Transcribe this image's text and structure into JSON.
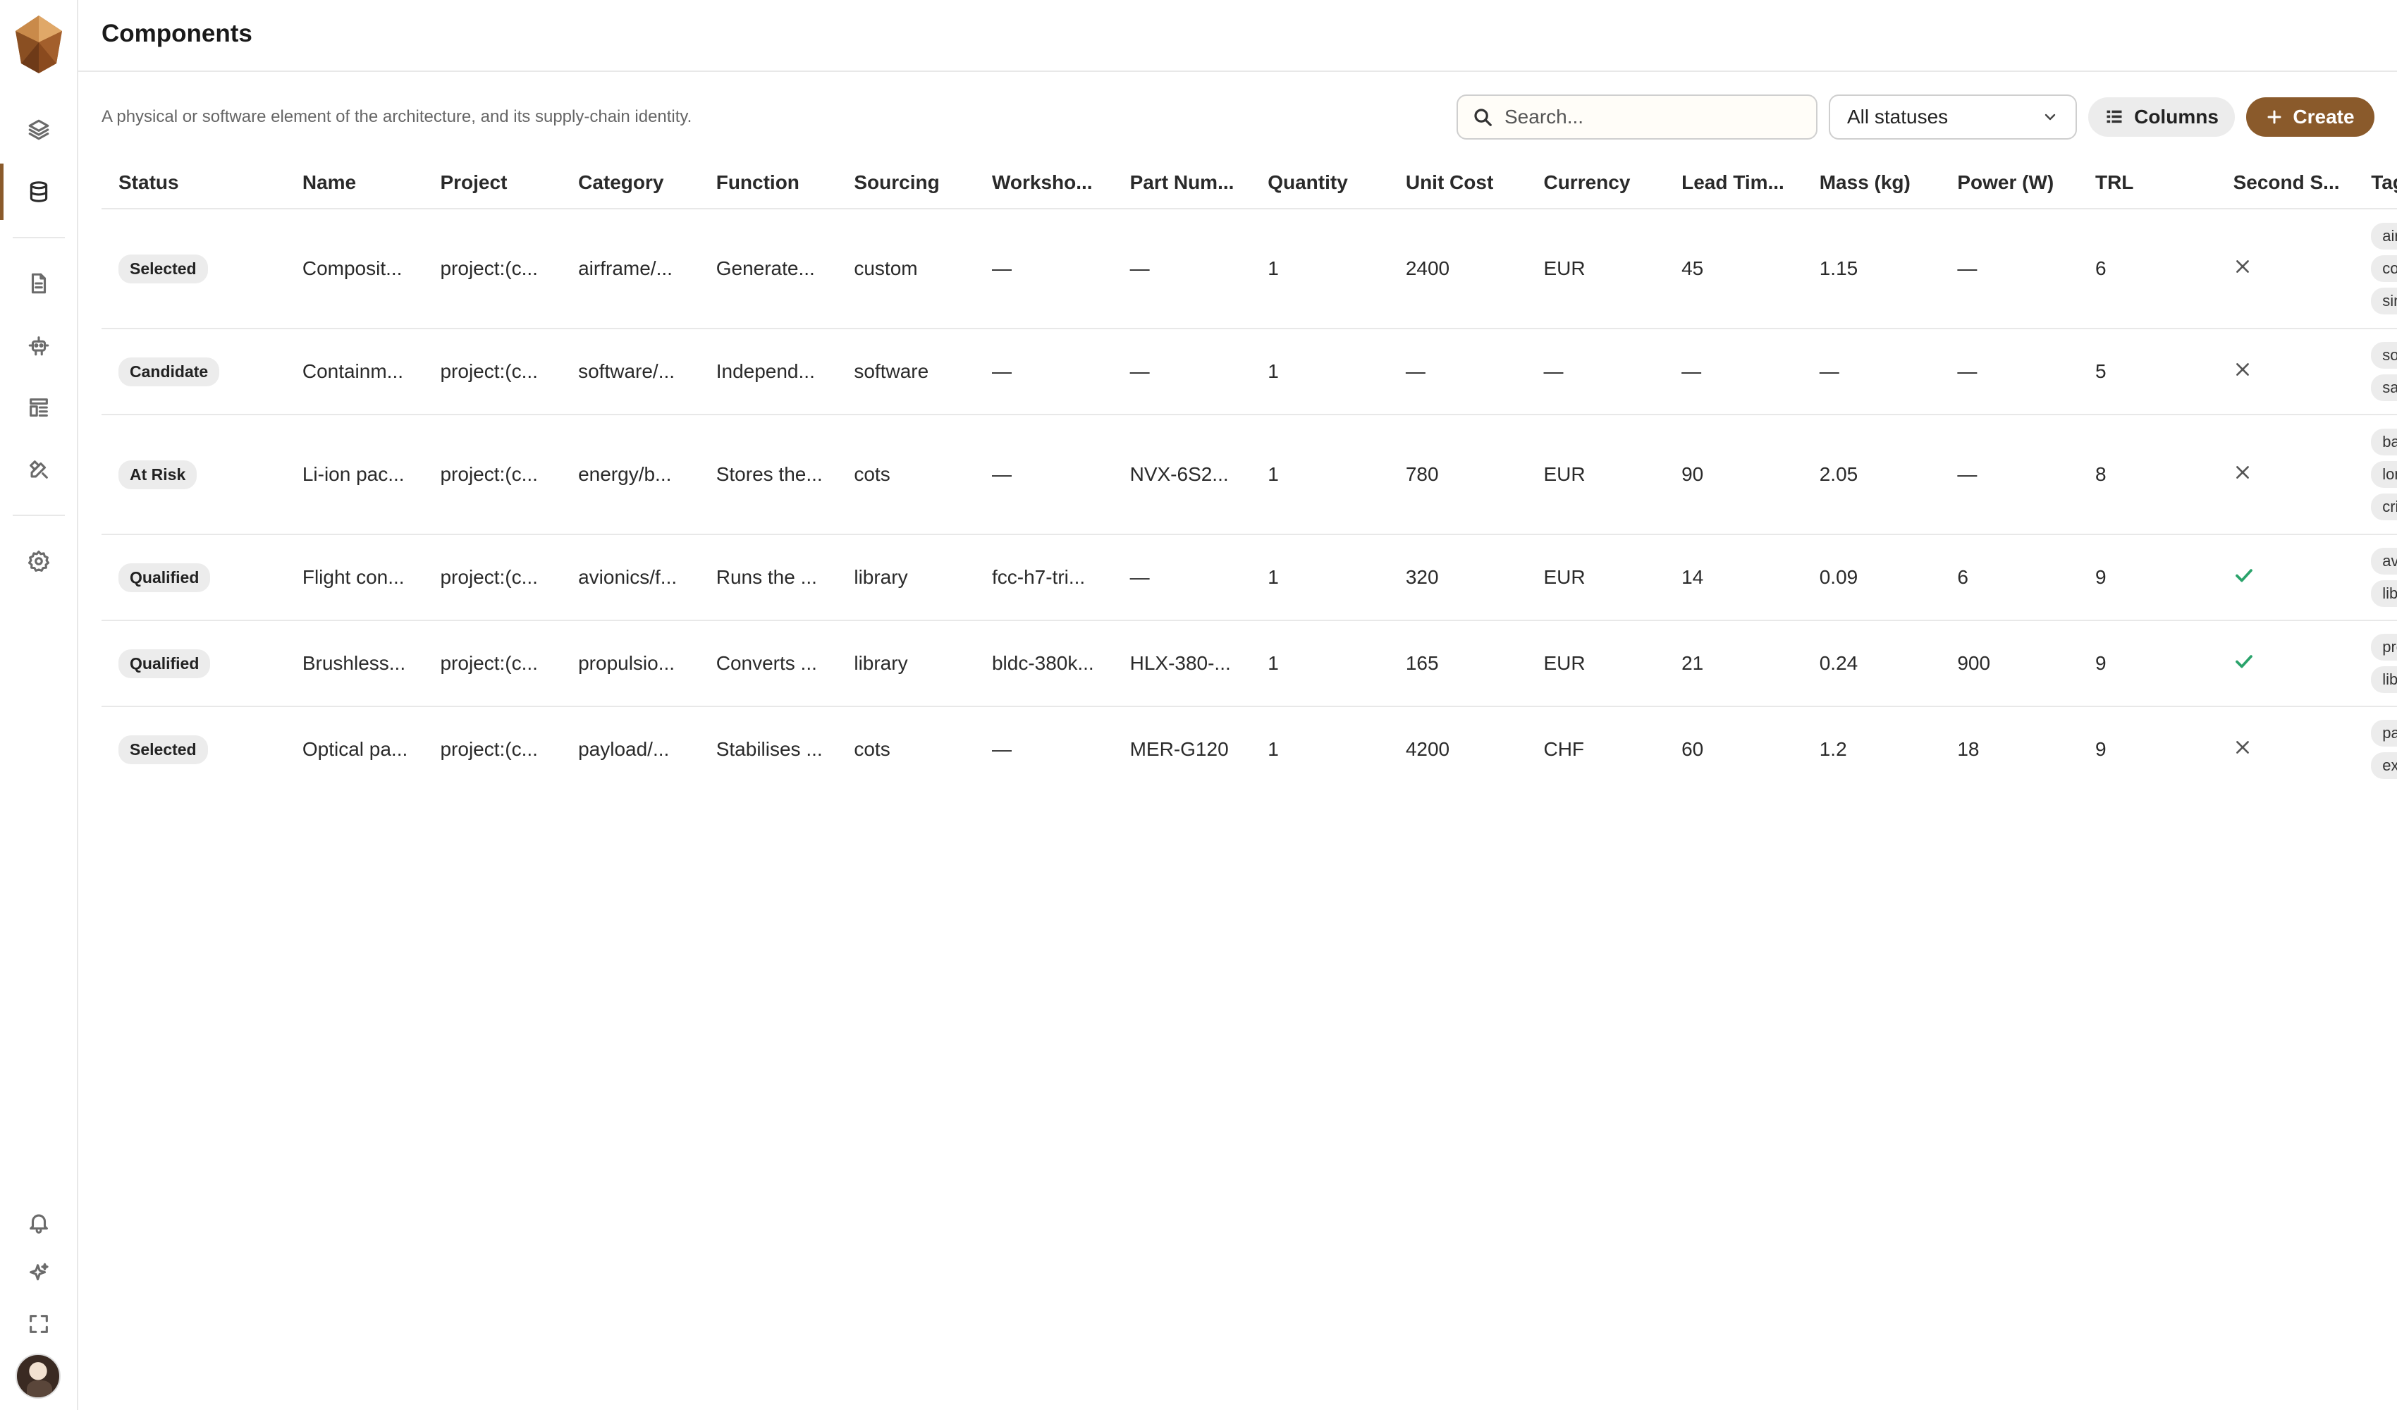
{
  "page": {
    "title": "Components",
    "description": "A physical or software element of the architecture, and its supply-chain identity."
  },
  "toolbar": {
    "search_placeholder": "Search...",
    "status_filter": "All statuses",
    "columns_label": "Columns",
    "create_label": "Create"
  },
  "table": {
    "headers": [
      "Status",
      "Name",
      "Project",
      "Category",
      "Function",
      "Sourcing",
      "Worksho...",
      "Part Num...",
      "Quantity",
      "Unit Cost",
      "Currency",
      "Lead Tim...",
      "Mass (kg)",
      "Power (W)",
      "TRL",
      "Second S...",
      "Tags"
    ],
    "rows": [
      {
        "status": "Selected",
        "name": "Composit...",
        "project": "project:(c...",
        "category": "airframe/...",
        "function": "Generate...",
        "sourcing": "custom",
        "workshop": "—",
        "part_number": "—",
        "quantity": "1",
        "unit_cost": "2400",
        "currency": "EUR",
        "lead_time": "45",
        "mass": "1.15",
        "power": "—",
        "trl": "6",
        "second_source": "no",
        "tags": [
          "airfra",
          "com",
          "sing"
        ]
      },
      {
        "status": "Candidate",
        "name": "Containm...",
        "project": "project:(c...",
        "category": "software/...",
        "function": "Independ...",
        "sourcing": "software",
        "workshop": "—",
        "part_number": "—",
        "quantity": "1",
        "unit_cost": "—",
        "currency": "—",
        "lead_time": "—",
        "mass": "—",
        "power": "—",
        "trl": "5",
        "second_source": "no",
        "tags": [
          "softw",
          "safet"
        ]
      },
      {
        "status": "At Risk",
        "name": "Li-ion pac...",
        "project": "project:(c...",
        "category": "energy/b...",
        "function": "Stores the...",
        "sourcing": "cots",
        "workshop": "—",
        "part_number": "NVX-6S2...",
        "quantity": "1",
        "unit_cost": "780",
        "currency": "EUR",
        "lead_time": "90",
        "mass": "2.05",
        "power": "—",
        "trl": "8",
        "second_source": "no",
        "tags": [
          "batte",
          "long",
          "critic"
        ]
      },
      {
        "status": "Qualified",
        "name": "Flight con...",
        "project": "project:(c...",
        "category": "avionics/f...",
        "function": "Runs the ...",
        "sourcing": "library",
        "workshop": "fcc-h7-tri...",
        "part_number": "—",
        "quantity": "1",
        "unit_cost": "320",
        "currency": "EUR",
        "lead_time": "14",
        "mass": "0.09",
        "power": "6",
        "trl": "9",
        "second_source": "yes",
        "tags": [
          "avior",
          "libra"
        ]
      },
      {
        "status": "Qualified",
        "name": "Brushless...",
        "project": "project:(c...",
        "category": "propulsio...",
        "function": "Converts ...",
        "sourcing": "library",
        "workshop": "bldc-380k...",
        "part_number": "HLX-380-...",
        "quantity": "1",
        "unit_cost": "165",
        "currency": "EUR",
        "lead_time": "21",
        "mass": "0.24",
        "power": "900",
        "trl": "9",
        "second_source": "yes",
        "tags": [
          "prop",
          "libra"
        ]
      },
      {
        "status": "Selected",
        "name": "Optical pa...",
        "project": "project:(c...",
        "category": "payload/...",
        "function": "Stabilises ...",
        "sourcing": "cots",
        "workshop": "—",
        "part_number": "MER-G120",
        "quantity": "1",
        "unit_cost": "4200",
        "currency": "CHF",
        "lead_time": "60",
        "mass": "1.2",
        "power": "18",
        "trl": "9",
        "second_source": "no",
        "tags": [
          "payl",
          "expc"
        ]
      }
    ]
  },
  "sidebar": {
    "items": [
      {
        "icon": "layers-icon"
      },
      {
        "icon": "database-icon",
        "active": true
      },
      {
        "icon": "document-icon"
      },
      {
        "icon": "robot-icon"
      },
      {
        "icon": "layout-icon"
      },
      {
        "icon": "tools-icon"
      },
      {
        "icon": "gear-icon"
      },
      {
        "icon": "bell-icon"
      },
      {
        "icon": "sparkle-icon"
      },
      {
        "icon": "fullscreen-icon"
      }
    ]
  },
  "colors": {
    "accent": "#8a5a2b",
    "check": "#2aa36b",
    "badge_bg": "#ececec"
  }
}
